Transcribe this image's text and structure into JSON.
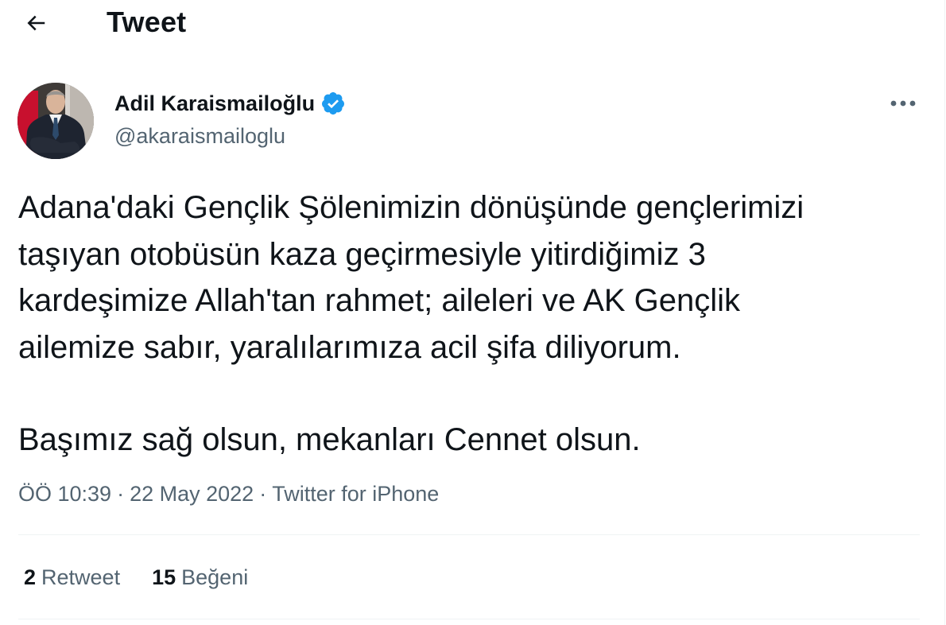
{
  "header": {
    "title": "Tweet",
    "back_icon": "arrow-left-icon"
  },
  "author": {
    "name": "Adil Karaismailoğlu",
    "handle": "@akaraismailoglu",
    "verified_icon": "verified-badge-icon",
    "verified_color": "#1d9bf0"
  },
  "more_icon": "more-horizontal-icon",
  "tweet": {
    "lines": [
      "Adana'daki Gençlik Şölenimizin dönüşünde gençlerimizi",
      "taşıyan otobüsün kaza geçirmesiyle yitirdiğimiz 3",
      "kardeşimize Allah'tan rahmet; aileleri ve AK Gençlik",
      "ailemize sabır, yaralılarımıza acil şifa diliyorum.",
      "Başımız sağ olsun, mekanları Cennet olsun."
    ],
    "time": "ÖÖ 10:39",
    "separator": "·",
    "date": "22 May 2022",
    "source": "Twitter for iPhone"
  },
  "stats": {
    "retweets": {
      "count": "2",
      "label": "Retweet"
    },
    "likes": {
      "count": "15",
      "label": "Beğeni"
    }
  },
  "colors": {
    "text_primary": "#0f1419",
    "text_secondary": "#536471",
    "divider": "#eff3f4",
    "accent": "#1d9bf0"
  }
}
